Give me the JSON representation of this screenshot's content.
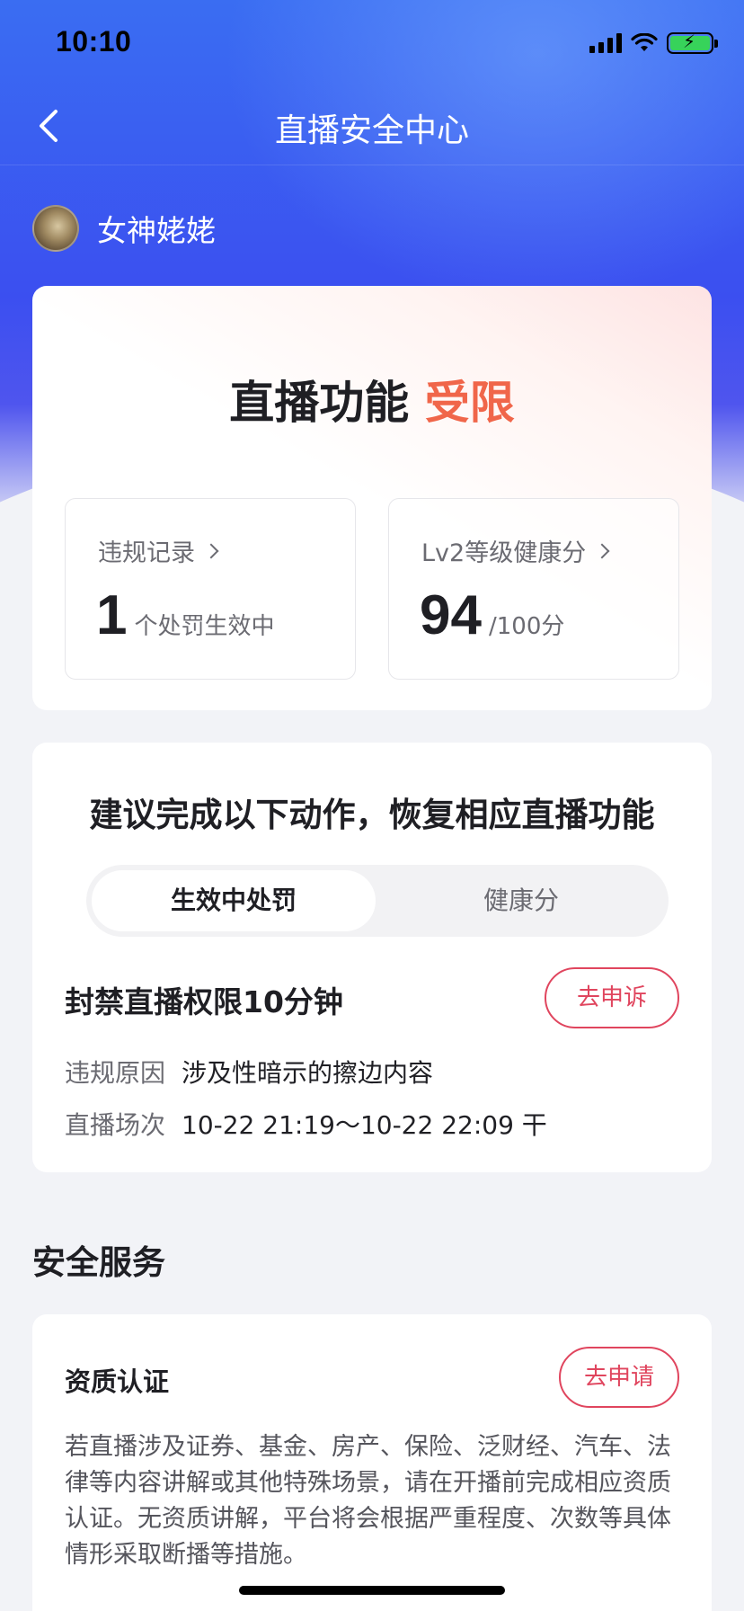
{
  "status_bar": {
    "time": "10:10"
  },
  "nav": {
    "title": "直播安全中心"
  },
  "user": {
    "name": "女神姥姥"
  },
  "status_card": {
    "headline_main": "直播功能",
    "headline_accent": "受限",
    "violations": {
      "label": "违规记录",
      "count": "1",
      "unit": "个处罚生效中"
    },
    "health": {
      "label": "Lv2等级健康分",
      "score": "94",
      "unit": "/100分"
    }
  },
  "actions_card": {
    "title": "建议完成以下动作，恢复相应直播功能",
    "tabs": [
      "生效中处罚",
      "健康分"
    ],
    "penalty": {
      "title": "封禁直播权限10分钟",
      "appeal_label": "去申诉",
      "reason_label": "违规原因",
      "reason_value": "涉及性暗示的擦边内容",
      "session_label": "直播场次",
      "session_value": "10-22 21:19～10-22 22:09 干"
    }
  },
  "services": {
    "section_title": "安全服务",
    "qualification": {
      "title": "资质认证",
      "apply_label": "去申请",
      "description": "若直播涉及证券、基金、房产、保险、泛财经、汽车、法律等内容讲解或其他特殊场景，请在开播前完成相应资质认证。无资质讲解，平台将会根据严重程度、次数等具体情形采取断播等措施。"
    }
  },
  "colors": {
    "accent_red": "#e0455e",
    "accent_orange": "#f0664a",
    "header_blue": "#3b4ff0"
  },
  "icons": [
    "back-icon",
    "signal-icon",
    "wifi-icon",
    "battery-icon"
  ]
}
